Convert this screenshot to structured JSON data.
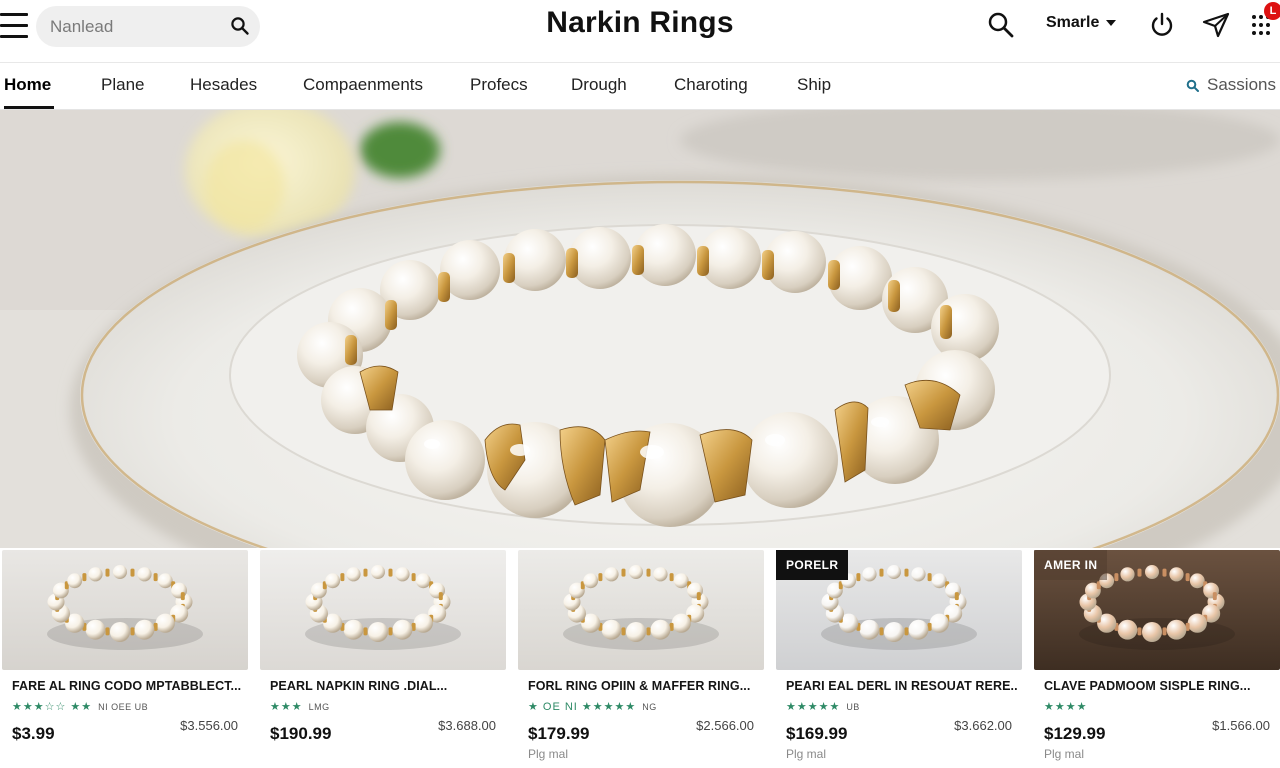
{
  "header": {
    "search_placeholder": "Nanlead",
    "brand": "Narkin Rings",
    "profile_label": "Smarle",
    "notification_badge": "L",
    "icons": [
      "menu-icon",
      "search-icon",
      "power-icon",
      "send-icon",
      "grid-dots-icon"
    ]
  },
  "nav": {
    "tabs": [
      {
        "label": "Home",
        "active": true
      },
      {
        "label": "Plane"
      },
      {
        "label": "Hesades"
      },
      {
        "label": "Compaenments"
      },
      {
        "label": "Profecs"
      },
      {
        "label": "Drough"
      },
      {
        "label": "Charoting"
      },
      {
        "label": "Ship"
      }
    ],
    "sessions_label": "Sassions"
  },
  "hero": {
    "image_subject": "pearl bracelet with gold caps on white plate"
  },
  "products": [
    {
      "title": "FARE AL RING CODO MPTABBLECT...",
      "rating_text": "NI OEE UB",
      "stars": "★★★☆☆ ★★",
      "price": "$3.99",
      "old_price": "$3.556.00",
      "sub": "",
      "tag": ""
    },
    {
      "title": "PEARL NAPKIN RING .DIAL...",
      "rating_text": "LMG",
      "stars": "★★★",
      "price": "$190.99",
      "old_price": "$3.688.00",
      "sub": "",
      "tag": ""
    },
    {
      "title": "FORL RING OPIIN & MAFFER RING...",
      "rating_text": "NG",
      "stars": "★ OE NI ★★★★★",
      "price": "$179.99",
      "old_price": "$2.566.00",
      "sub": "Plg mal",
      "tag": ""
    },
    {
      "title": "PEARI EAL DERL IN RESOUAT RERE...",
      "rating_text": "UB",
      "stars": "★★★★★",
      "price": "$169.99",
      "old_price": "$3.662.00",
      "sub": "Plg mal",
      "tag": "PORELR"
    },
    {
      "title": "CLAVE PADMOOM SISPLE RING...",
      "rating_text": "",
      "stars": "★★★★",
      "price": "$129.99",
      "old_price": "$1.566.00",
      "sub": "Plg mal",
      "tag": "AMER IN"
    }
  ],
  "colors": {
    "accent_green": "#2e8a66",
    "badge_red": "#dd1111",
    "gold": "#c9973f",
    "pearl": "#f3ece0"
  }
}
